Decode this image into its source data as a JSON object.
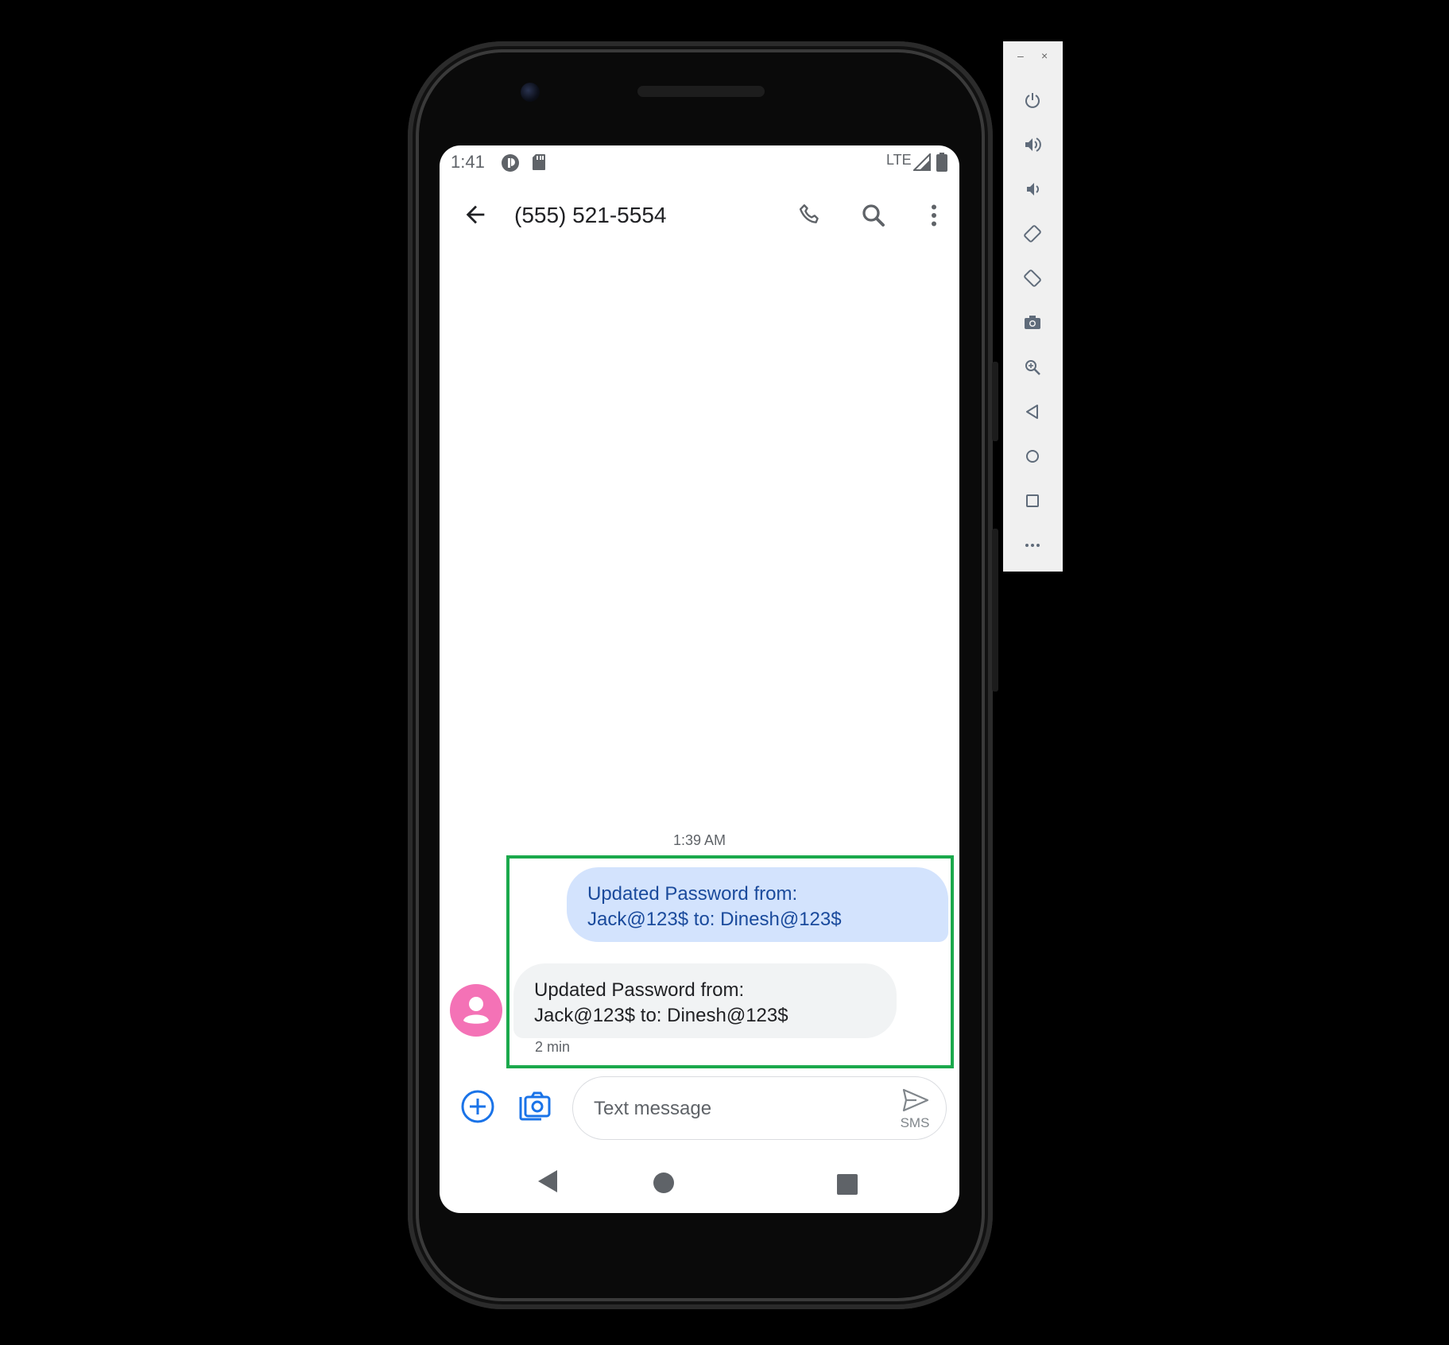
{
  "status_bar": {
    "time": "1:41",
    "network": "LTE"
  },
  "app_bar": {
    "title": "(555) 521-5554",
    "icons": [
      "back-arrow-icon",
      "phone-icon",
      "search-icon",
      "more-vert-icon"
    ]
  },
  "conversation": {
    "timestamp": "1:39 AM",
    "outgoing": {
      "lines": [
        "Updated Password from:",
        "Jack@123$ to: Dinesh@123$"
      ]
    },
    "incoming": {
      "lines": [
        "Updated Password from:",
        "Jack@123$ to: Dinesh@123$"
      ],
      "time": "2 min"
    }
  },
  "compose": {
    "placeholder": "Text message",
    "send_label": "SMS"
  },
  "emulator_toolbar": {
    "minimize": "–",
    "close": "×",
    "buttons": [
      "power-icon",
      "volume-up-icon",
      "volume-down-icon",
      "rotate-left-icon",
      "rotate-right-icon",
      "camera-icon",
      "zoom-icon",
      "back-icon",
      "home-icon",
      "overview-icon",
      "more-icon"
    ]
  },
  "colors": {
    "outgoing_bubble": "#d3e3fd",
    "incoming_bubble": "#f1f3f4",
    "avatar": "#f472b6",
    "accent": "#1a73e8",
    "highlight_border": "#1ba94c"
  }
}
